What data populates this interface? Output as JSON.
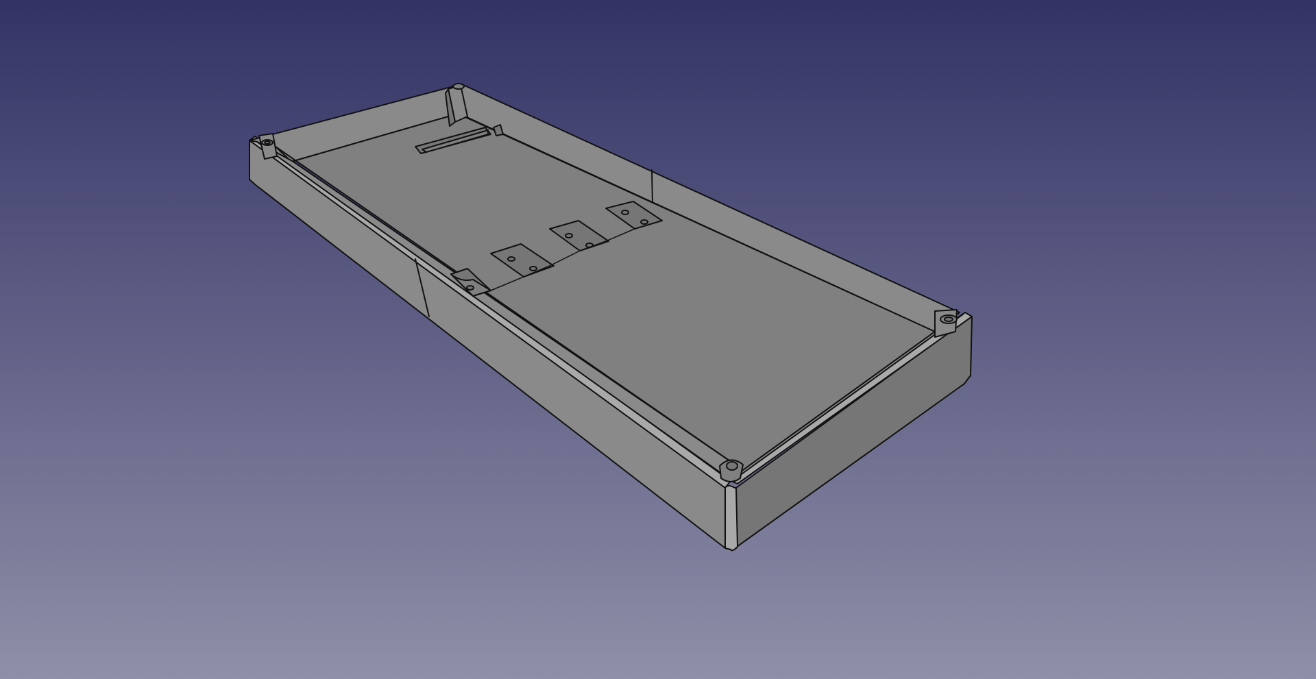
{
  "viewport": {
    "background_top": "#333366",
    "background_bottom": "#8f8fa8"
  },
  "model": {
    "face_color": "#808080",
    "wall_light": "#8a8a8a",
    "wall_dark": "#767676",
    "edge_color": "#111111",
    "highlight": "#a9a9a9"
  }
}
